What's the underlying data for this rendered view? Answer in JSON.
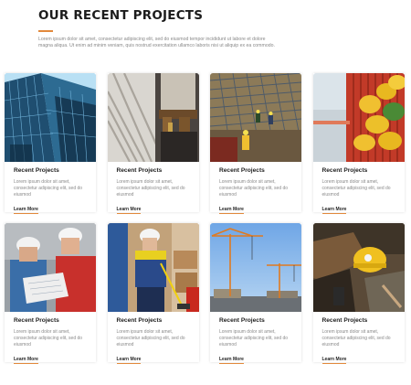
{
  "section": {
    "title": "OUR RECENT PROJECTS",
    "description": "Lorem ipsum dolor sit amet, consectetur adipiscing elit, sed do eiusmod tempor incididunt ut labore et dolore magna aliqua. Ut enim ad minim veniam, quis nostrud exercitation ullamco laboris nisi ut aliquip ex ea commodo."
  },
  "accent_color": "#e2893c",
  "projects": [
    {
      "title": "Recent Projects",
      "text": "Lorem ipsum dolor sit amet, consectetur adipiscing elit, sed do eiusmod",
      "link": "Learn More",
      "image": "glass-skyscraper"
    },
    {
      "title": "Recent Projects",
      "text": "Lorem ipsum dolor sit amet, consectetur adipiscing elit, sed do eiusmod",
      "link": "Learn More",
      "image": "worker-tool-belt"
    },
    {
      "title": "Recent Projects",
      "text": "Lorem ipsum dolor sit amet, consectetur adipiscing elit, sed do eiusmod",
      "link": "Learn More",
      "image": "rebar-construction-site"
    },
    {
      "title": "Recent Projects",
      "text": "Lorem ipsum dolor sit amet, consectetur adipiscing elit, sed do eiusmod",
      "link": "Learn More",
      "image": "hardhats-containers"
    },
    {
      "title": "Recent Projects",
      "text": "Lorem ipsum dolor sit amet, consectetur adipiscing elit, sed do eiusmod",
      "link": "Learn More",
      "image": "engineers-reviewing-plans"
    },
    {
      "title": "Recent Projects",
      "text": "Lorem ipsum dolor sit amet, consectetur adipiscing elit, sed do eiusmod",
      "link": "Learn More",
      "image": "worker-with-broom"
    },
    {
      "title": "Recent Projects",
      "text": "Lorem ipsum dolor sit amet, consectetur adipiscing elit, sed do eiusmod",
      "link": "Learn More",
      "image": "tower-cranes"
    },
    {
      "title": "Recent Projects",
      "text": "Lorem ipsum dolor sit amet, consectetur adipiscing elit, sed do eiusmod",
      "link": "Learn More",
      "image": "hardhat-on-ground"
    }
  ]
}
